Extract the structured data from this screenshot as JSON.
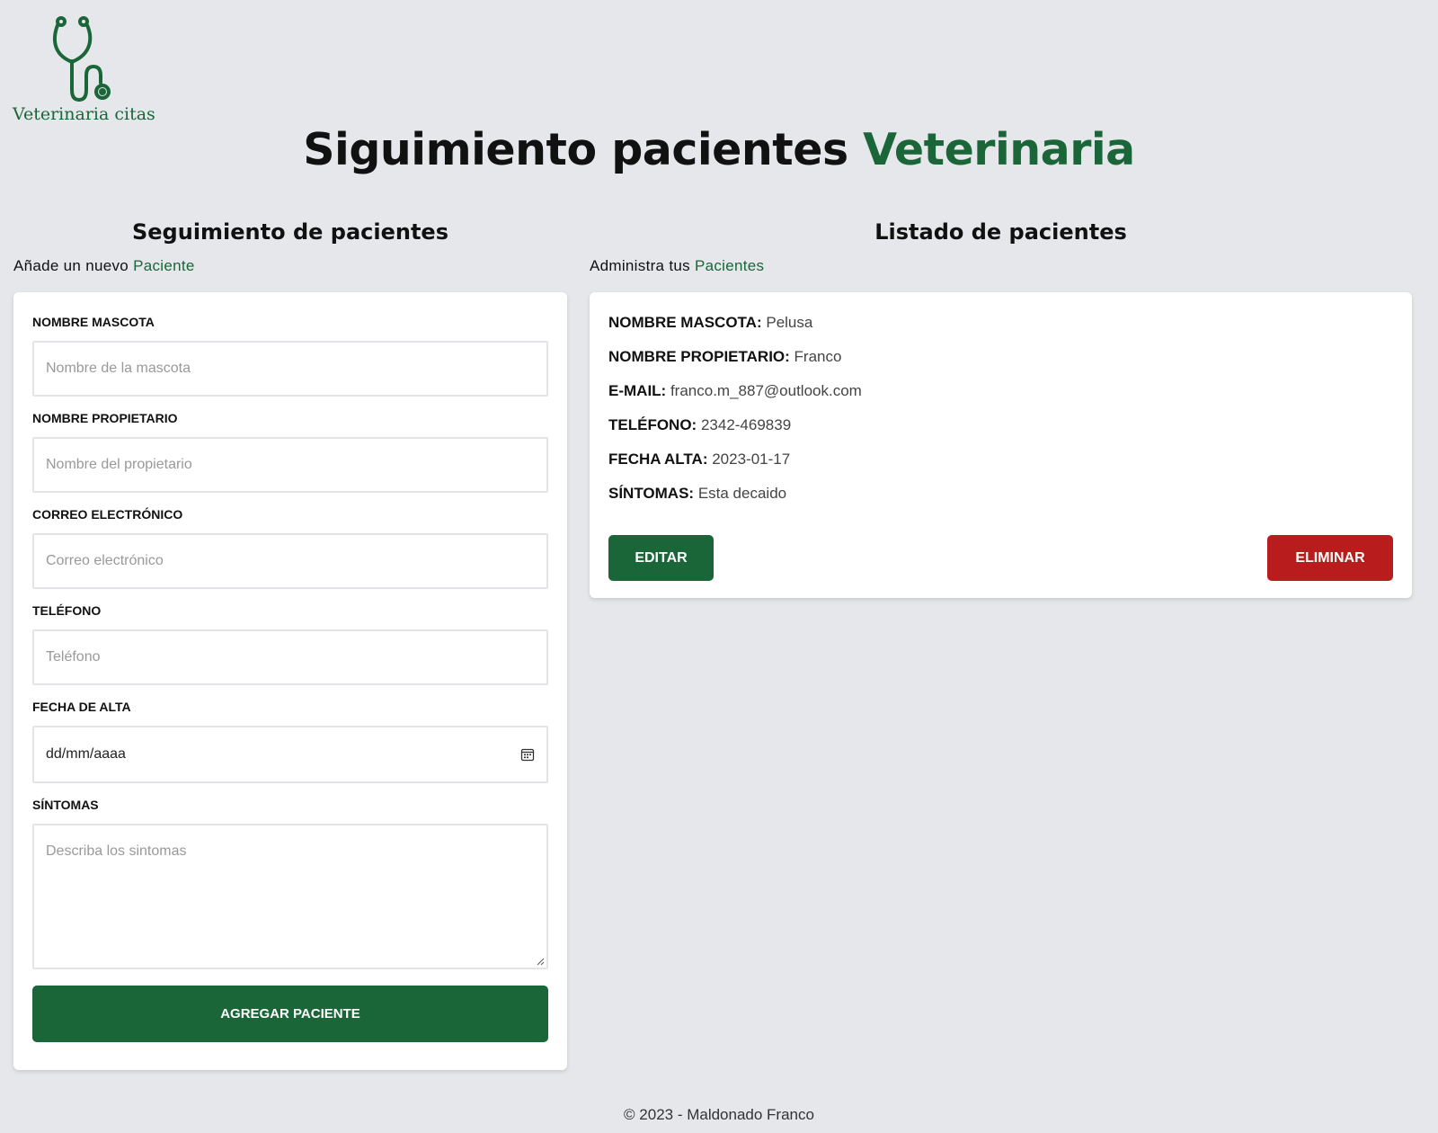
{
  "logo": {
    "text": "Veterinaria citas",
    "icon": "stethoscope-icon"
  },
  "header": {
    "title_main": "Siguimiento pacientes ",
    "title_accent": "Veterinaria"
  },
  "form_section": {
    "title": "Seguimiento de pacientes",
    "subtitle_prefix": "Añade un nuevo ",
    "subtitle_accent": "Paciente",
    "fields": {
      "pet_name": {
        "label": "NOMBRE MASCOTA",
        "placeholder": "Nombre de la mascota"
      },
      "owner_name": {
        "label": "NOMBRE PROPIETARIO",
        "placeholder": "Nombre del propietario"
      },
      "email": {
        "label": "CORREO ELECTRÓNICO",
        "placeholder": "Correo electrónico"
      },
      "phone": {
        "label": "TELÉFONO",
        "placeholder": "Teléfono"
      },
      "date": {
        "label": "FECHA DE ALTA",
        "placeholder": "dd/mm/aaaa",
        "icon": "calendar-icon"
      },
      "symptoms": {
        "label": "SÍNTOMAS",
        "placeholder": "Describa los sintomas"
      }
    },
    "submit_label": "AGREGAR PACIENTE"
  },
  "list_section": {
    "title": "Listado de pacientes",
    "subtitle_prefix": "Administra tus ",
    "subtitle_accent": "Pacientes",
    "patients": [
      {
        "rows": [
          {
            "key": "NOMBRE MASCOTA:",
            "value": "Pelusa"
          },
          {
            "key": "NOMBRE PROPIETARIO:",
            "value": "Franco"
          },
          {
            "key": "E-MAIL:",
            "value": "franco.m_887@outlook.com"
          },
          {
            "key": "TELÉFONO:",
            "value": "2342-469839"
          },
          {
            "key": "FECHA ALTA:",
            "value": "2023-01-17"
          },
          {
            "key": "SÍNTOMAS:",
            "value": "Esta decaido"
          }
        ],
        "edit_label": "EDITAR",
        "delete_label": "ELIMINAR"
      }
    ]
  },
  "footer": {
    "text": "© 2023 - Maldonado Franco"
  },
  "colors": {
    "accent": "#1a6638",
    "danger": "#b91c1c",
    "background": "#e5e7eb"
  }
}
